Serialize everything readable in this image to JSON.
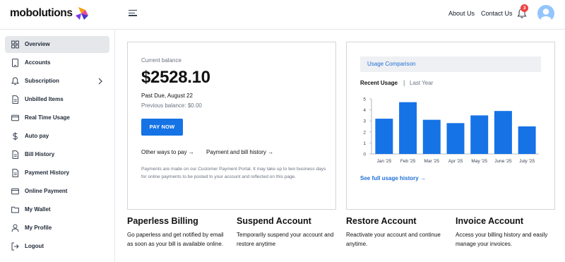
{
  "header": {
    "logo_text": "mobolutions",
    "about_label": "About Us",
    "contact_label": "Contact Us",
    "notification_count": "3",
    "colors": {
      "accent": "#1573e6",
      "badge": "#ef4444"
    }
  },
  "sidebar": {
    "items": [
      {
        "label": "Overview",
        "icon": "grid-icon",
        "active": true
      },
      {
        "label": "Accounts",
        "icon": "tablet-icon"
      },
      {
        "label": "Subscription",
        "icon": "bell-icon",
        "chevron": "chevron-right-icon"
      },
      {
        "label": "Unbilled Items",
        "icon": "document-icon"
      },
      {
        "label": "Real Time Usage",
        "icon": "credit-card-icon"
      },
      {
        "label": "Auto pay",
        "icon": "dollar-icon"
      },
      {
        "label": "Bill History",
        "icon": "document-icon"
      },
      {
        "label": "Payment History",
        "icon": "document-icon"
      },
      {
        "label": "Online Payment",
        "icon": "credit-card-icon"
      },
      {
        "label": "My Wallet",
        "icon": "folder-icon"
      },
      {
        "label": "My Profile",
        "icon": "user-icon"
      },
      {
        "label": "Logout",
        "icon": "logout-icon"
      }
    ]
  },
  "balance": {
    "label": "Current balance",
    "amount": "$2528.10",
    "due": "Past Due, August 22",
    "previous": "Previous balance: $0.00",
    "pay_button": "PAY NOW",
    "other_ways": "Other ways to pay →",
    "history_link": "Payment and bill history →",
    "note": "Payments are made on our Customer Payment Portal. It may take up to two business days for online payments to be posted to your account and reflected on this page."
  },
  "usage": {
    "header": "Usage Comparison",
    "tab_recent": "Recent Usage",
    "tab_separator": "|",
    "tab_last": "Last Year",
    "see_full": "See full usage history →"
  },
  "chart_data": {
    "type": "bar",
    "categories": [
      "Jan '25",
      "Feb '25",
      "Mar '25",
      "Apr '25",
      "May '25",
      "June '25",
      "July '25"
    ],
    "values": [
      3.2,
      4.7,
      3.1,
      2.8,
      3.5,
      3.9,
      2.5
    ],
    "ylim": [
      0,
      5
    ],
    "yticks": [
      "0",
      "1",
      "2",
      "3",
      "4",
      "5"
    ],
    "bar_color": "#1573e6",
    "grid": false
  },
  "features": [
    {
      "title": "Paperless Billing",
      "desc": "Go paperless and get notified by email as soon as your bill is available online."
    },
    {
      "title": "Suspend Account",
      "desc": "Temporarily suspend your account and restore anytime"
    },
    {
      "title": "Restore Account",
      "desc": "Reactivate your account and continue anytime."
    },
    {
      "title": "Invoice Account",
      "desc": "Access your billing history and easily manage your invoices."
    }
  ]
}
